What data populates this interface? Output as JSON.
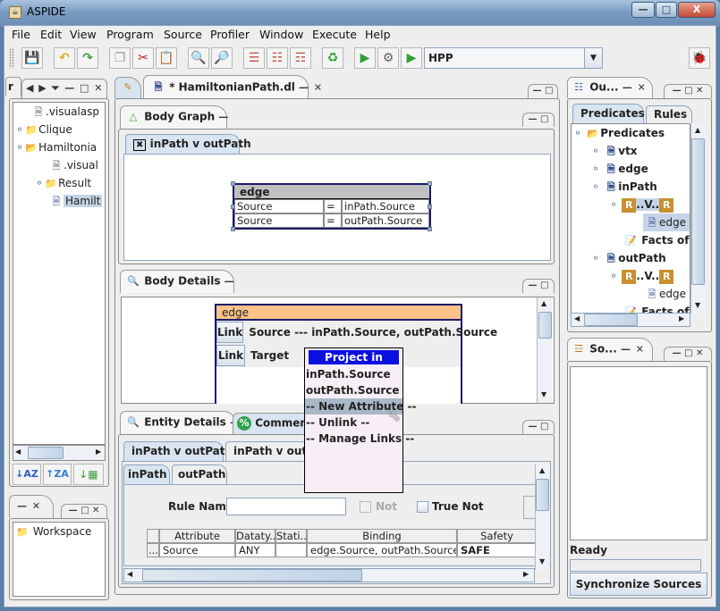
{
  "window": {
    "title": "ASPIDE",
    "minimize_icon": "minimize-icon",
    "maximize_icon": "maximize-icon",
    "close_icon": "close-icon",
    "min_glyph": "—",
    "max_glyph": "□",
    "close_glyph": "X"
  },
  "menubar": {
    "items": [
      "File",
      "Edit",
      "View",
      "Program",
      "Source",
      "Profiler",
      "Window",
      "Execute",
      "Help"
    ]
  },
  "toolbar": {
    "buttons": [
      {
        "name": "save-icon",
        "glyph": "💾"
      },
      {
        "name": "undo-icon",
        "glyph": "↶"
      },
      {
        "name": "redo-icon",
        "glyph": "↷"
      },
      {
        "name": "copy-icon",
        "glyph": "❐"
      },
      {
        "name": "cut-icon",
        "glyph": "✂"
      },
      {
        "name": "paste-icon",
        "glyph": "📋"
      },
      {
        "name": "find-icon",
        "glyph": "🔍"
      },
      {
        "name": "find-replace-icon",
        "glyph": "🔎"
      },
      {
        "name": "rule-icon",
        "glyph": "☰"
      },
      {
        "name": "rules-icon",
        "glyph": "☷"
      },
      {
        "name": "rule-tree-icon",
        "glyph": "☶"
      },
      {
        "name": "refresh-icon",
        "glyph": "♻"
      },
      {
        "name": "run-list-icon",
        "glyph": "▶"
      },
      {
        "name": "debug-run-icon",
        "glyph": "⚙"
      },
      {
        "name": "run-icon",
        "glyph": "▶"
      }
    ],
    "solver_combo": {
      "value": "HPP"
    },
    "debug_glyph": "🐞"
  },
  "left_panel": {
    "tab_stub": "r",
    "controls": "◀ ▶ ⏷ — □ ✕",
    "tree": [
      {
        "label": ".visualasp",
        "icon": "xml-file-icon",
        "level": 1
      },
      {
        "label": "Clique",
        "icon": "project-folder-icon",
        "level": 0
      },
      {
        "label": "Hamiltonia",
        "icon": "project-folder-icon",
        "level": 0
      },
      {
        "label": ".visual",
        "icon": "xml-file-icon",
        "level": 1
      },
      {
        "label": "Result",
        "icon": "folder-icon",
        "level": 1
      },
      {
        "label": "Hamilt",
        "icon": "dlv-file-icon",
        "level": 1,
        "selected": true
      }
    ],
    "sort_buttons": [
      "sort-ascending-icon",
      "sort-descending-icon",
      "group-icon"
    ],
    "workspace_panel": {
      "controls_left": "— ✕",
      "controls_right": "— □ ✕",
      "item": "Workspace"
    }
  },
  "editor": {
    "tabs": [
      {
        "label": "",
        "icon": "edit-pencil-icon"
      },
      {
        "label": "* HamiltonianPath.dl",
        "icon": "dlv-file-icon",
        "controls": "— ✕"
      }
    ],
    "body_graph": {
      "title": "Body Graph",
      "rule_tab": "inPath v outPath",
      "atom": {
        "name": "edge",
        "rows": [
          {
            "attr": "Source",
            "op": "=",
            "value": "inPath.Source"
          },
          {
            "attr": "Source",
            "op": "=",
            "value": "outPath.Source"
          }
        ]
      }
    },
    "body_details": {
      "title": "Body Details",
      "atom": "edge",
      "rows": [
        {
          "button": "Link",
          "text": "Source --- inPath.Source, outPath.Source"
        },
        {
          "button": "Link",
          "text": "Target"
        }
      ]
    },
    "popup_menu": {
      "header": "Project in Head",
      "items": [
        {
          "label": "inPath.Source"
        },
        {
          "label": "outPath.Source"
        },
        {
          "label": "--  New Attribute  --",
          "highlighted": true
        },
        {
          "label": "--  Unlink  --"
        },
        {
          "label": "--  Manage Links  --"
        }
      ]
    },
    "entity_details": {
      "title": "Entity Details",
      "comment_tab": "Comment",
      "rule_tabs": [
        "inPath v outPath",
        "inPath v outPa"
      ],
      "atom_tabs": [
        "inPath",
        "outPath"
      ],
      "rule_name_label": "Rule Name",
      "rule_name_value": "",
      "not_label": "Not",
      "true_not_label": "True Not",
      "table": {
        "columns": [
          "",
          "Attribute",
          "Dataty...",
          "Stati...",
          "Binding",
          "Safety"
        ],
        "rows": [
          [
            "...",
            "Source",
            "ANY",
            "",
            "edge.Source, outPath.Source",
            "SAFE"
          ]
        ]
      }
    }
  },
  "outline_panel": {
    "title": "Ou...",
    "tabs": [
      "Predicates",
      "Rules"
    ],
    "tree": [
      {
        "label": "Predicates",
        "icon": "predicates-folder-icon",
        "level": 0
      },
      {
        "label": "vtx",
        "icon": "predicate-icon",
        "level": 1
      },
      {
        "label": "edge",
        "icon": "predicate-icon",
        "level": 1
      },
      {
        "label": "inPath",
        "icon": "predicate-icon",
        "level": 1
      },
      {
        "label": "..V..",
        "icon": "rule-icon",
        "level": 2,
        "selected": true
      },
      {
        "label": "edge",
        "icon": "predicate-icon",
        "level": 3
      },
      {
        "label": "Facts of",
        "icon": "facts-icon",
        "level": 2
      },
      {
        "label": "outPath",
        "icon": "predicate-icon",
        "level": 1
      },
      {
        "label": "..V..",
        "icon": "rule-icon",
        "level": 2
      },
      {
        "label": "edge",
        "icon": "predicate-icon",
        "level": 3
      },
      {
        "label": "Facts of",
        "icon": "facts-icon",
        "level": 2
      }
    ]
  },
  "sources_panel": {
    "title": "So...",
    "status": "Ready",
    "progress": 0,
    "sync_button": "Synchronize Sources"
  }
}
